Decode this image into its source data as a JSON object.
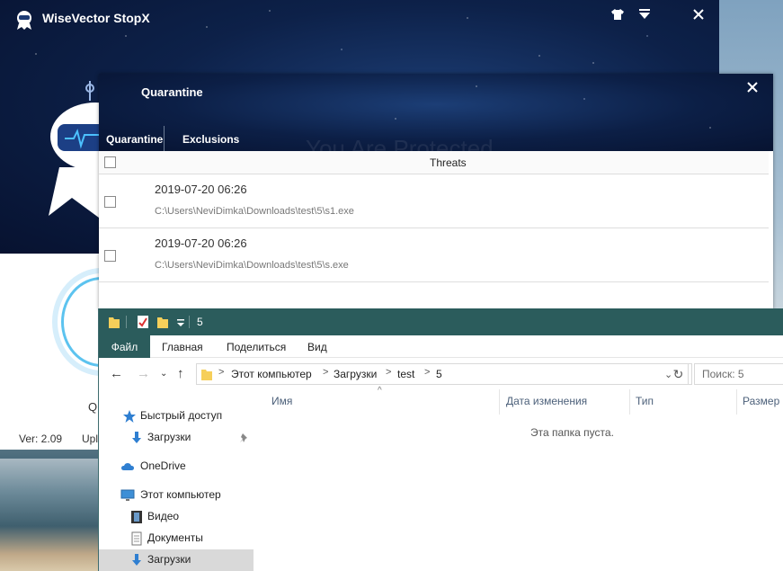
{
  "stopx": {
    "title": "WiseVector StopX",
    "fragment_q": "Q",
    "version": "Ver: 2.09",
    "update_fragment": "Upl"
  },
  "quarantine": {
    "title": "Quarantine",
    "tabs": [
      "Quarantine",
      "Exclusions"
    ],
    "watermark": "You Are Protected",
    "column_threats": "Threats",
    "rows": [
      {
        "date": "2019-07-20 06:26",
        "path": "C:\\Users\\NeviDimka\\Downloads\\test\\5\\s1.exe"
      },
      {
        "date": "2019-07-20 06:26",
        "path": "C:\\Users\\NeviDimka\\Downloads\\test\\5\\s.exe"
      }
    ]
  },
  "explorer": {
    "window_title": "5",
    "ribbon": {
      "file": "Файл",
      "home": "Главная",
      "share": "Поделиться",
      "view": "Вид"
    },
    "address": [
      "Этот компьютер",
      "Загрузки",
      "test",
      "5"
    ],
    "search_placeholder": "Поиск: 5",
    "sidebar": {
      "quick_access": "Быстрый доступ",
      "downloads_pinned": "Загрузки",
      "onedrive": "OneDrive",
      "this_pc": "Этот компьютер",
      "video": "Видео",
      "documents": "Документы",
      "downloads": "Загрузки"
    },
    "columns": {
      "name": "Имя",
      "date": "Дата изменения",
      "type": "Тип",
      "size": "Размер"
    },
    "empty_text": "Эта папка пуста."
  },
  "colors": {
    "explorer_accent": "#2b5c5c",
    "link_blue": "#5cc3ef"
  }
}
